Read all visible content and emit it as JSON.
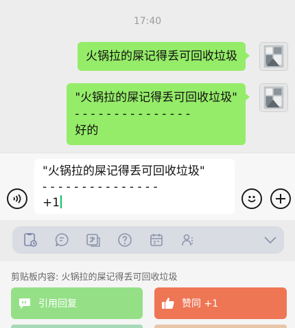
{
  "chat": {
    "time": "17:40",
    "messages": [
      {
        "text": "火锅拉的屎记得丢可回收垃圾"
      },
      {
        "text": "\"火锅拉的屎记得丢可回收垃圾\"\n- - - - - - - - - - - - - - -\n好的"
      }
    ]
  },
  "input": {
    "text": "\"火锅拉的屎记得丢可回收垃圾\"\n- - - - - - - - - - - - - - -\n+1"
  },
  "toolbar": {
    "icons": [
      "clipboard-icon",
      "chat-icon",
      "translate-icon",
      "question-icon",
      "calendar-icon",
      "people-icon",
      "collapse-icon"
    ]
  },
  "clipboard": {
    "label": "剪贴板内容: 火锅拉的屎记得丢可回收垃圾",
    "quote_button": "引用回复",
    "like_button": "赞同 +1"
  },
  "colors": {
    "bubble": "#95ec69",
    "quote_button": "#95e087",
    "like_button": "#ee7655"
  }
}
